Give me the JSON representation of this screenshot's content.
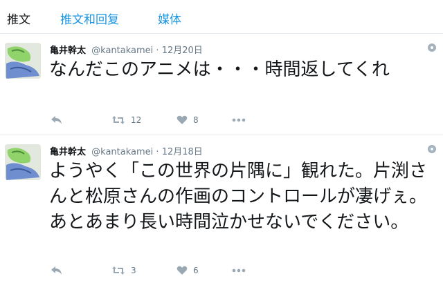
{
  "tabs": [
    {
      "label": "推文"
    },
    {
      "label": "推文和回复"
    },
    {
      "label": "媒体"
    }
  ],
  "tweets": [
    {
      "name": "亀井幹太",
      "handle": "@kantakamei",
      "separator": "·",
      "time": "12月20日",
      "text": "なんだこのアニメは・・・時間返してくれ",
      "retweets": "12",
      "likes": "8"
    },
    {
      "name": "亀井幹太",
      "handle": "@kantakamei",
      "separator": "·",
      "time": "12月18日",
      "text": "ようやく「この世界の片隅に」観れた。片渕さんと松原さんの作画のコントロールが凄げぇ。あとあまり長い時間泣かせないでください。",
      "retweets": "3",
      "likes": "6"
    }
  ],
  "icons": {
    "reply": "reply-icon",
    "retweet": "retweet-icon",
    "like": "heart-icon",
    "more": "more-icon",
    "settings": "gear-icon"
  },
  "colors": {
    "accent": "#1b95e0",
    "muted": "#657786",
    "text": "#14171a"
  }
}
